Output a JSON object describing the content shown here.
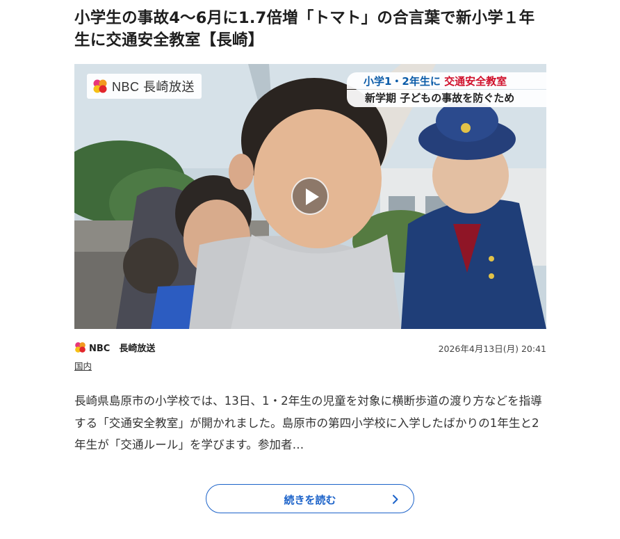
{
  "article": {
    "title": "小学生の事故4〜6月に1.7倍増「トマト」の合言葉で新小学１年生に交通安全教室【長崎】",
    "source_name": "NBC　長崎放送",
    "timestamp": "2026年4月13日(月) 20:41",
    "category": "国内",
    "summary": "長崎県島原市の小学校では、13日、1・2年生の児童を対象に横断歩道の渡り方などを指導する「交通安全教室」が開かれました。島原市の第四小学校に入学したばかりの1年生と2年生が「交通ルール」を学びます。参加者…",
    "read_more_label": "続きを読む"
  },
  "media": {
    "watermark": "NBC 長崎放送",
    "caption_line1_prefix": "小学1・2年生に",
    "caption_line1_highlight": "交通安全教室",
    "caption_line2": "新学期 子どもの事故を防ぐため"
  },
  "colors": {
    "accent_blue": "#1b62c9",
    "caption_red": "#d0102b",
    "caption_blue": "#0a5ba8"
  },
  "icons": {
    "play": "play-icon",
    "logo": "nbc-logo-icon",
    "chevron": "chevron-right-icon"
  }
}
